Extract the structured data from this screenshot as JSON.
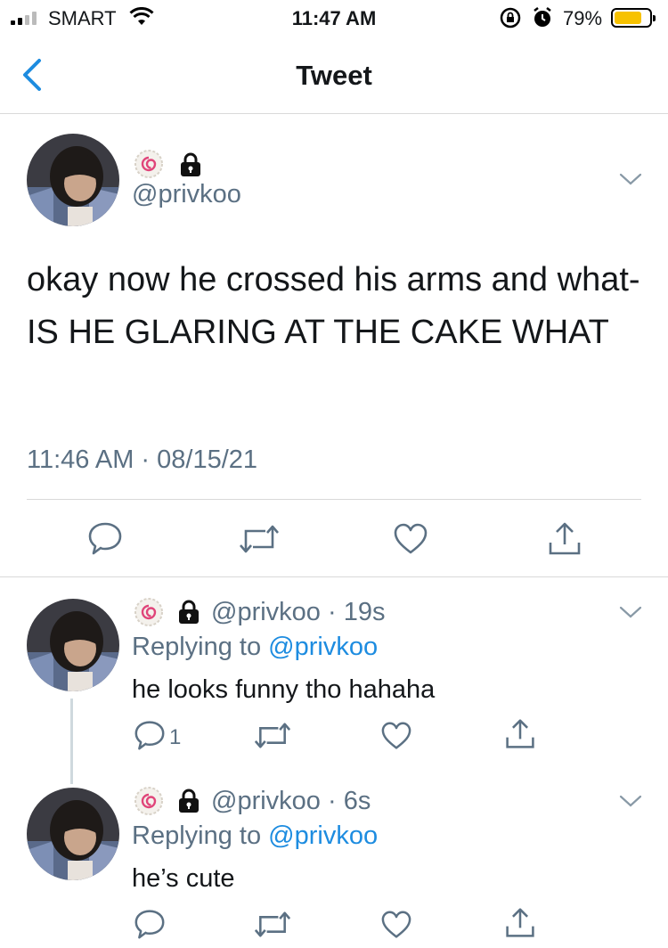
{
  "status_bar": {
    "carrier": "SMART",
    "time": "11:47 AM",
    "battery_percent": "79%",
    "battery_level": 0.79,
    "battery_color": "#f7c200",
    "icons": [
      "signal-icon",
      "wifi-icon",
      "rotation-lock-icon",
      "alarm-icon",
      "battery-icon"
    ]
  },
  "nav": {
    "title": "Tweet",
    "back_icon": "chevron-left-icon",
    "accent_color": "#1d8ce0"
  },
  "main_tweet": {
    "handle": "@privkoo",
    "text": "okay now he crossed his arms and what- IS HE GLARING AT THE CAKE WHAT",
    "timestamp": "11:46 AM · 08/15/21",
    "actions": [
      "reply-icon",
      "retweet-icon",
      "like-icon",
      "share-icon"
    ]
  },
  "replies": [
    {
      "handle_time": "@privkoo · 19s",
      "replying_prefix": "Replying to ",
      "replying_to": "@privkoo",
      "text": "he looks funny tho hahaha",
      "reply_count": "1"
    },
    {
      "handle_time": "@privkoo · 6s",
      "replying_prefix": "Replying to ",
      "replying_to": "@privkoo",
      "text": "he’s cute",
      "reply_count": ""
    }
  ]
}
